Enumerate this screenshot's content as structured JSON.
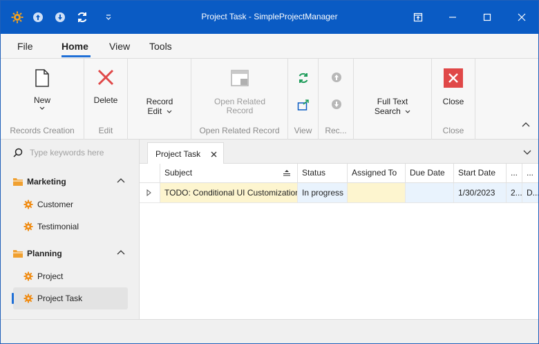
{
  "window": {
    "title": "Project Task - SimpleProjectManager"
  },
  "menu": {
    "tabs": [
      {
        "label": "File"
      },
      {
        "label": "Home"
      },
      {
        "label": "View"
      },
      {
        "label": "Tools"
      }
    ],
    "active_tab": "Home"
  },
  "ribbon": {
    "groups": {
      "records_creation": {
        "label": "Records Creation",
        "new_label": "New"
      },
      "edit": {
        "label": "Edit",
        "delete_label": "Delete"
      },
      "record_edit": {
        "label_line1": "Record",
        "label_line2": "Edit"
      },
      "open_related": {
        "label": "Open Related Record",
        "btn_line1": "Open Related",
        "btn_line2": "Record"
      },
      "view": {
        "label": "View"
      },
      "rec": {
        "label": "Rec..."
      },
      "search": {
        "line1": "Full Text",
        "line2": "Search"
      },
      "close": {
        "label": "Close",
        "close_label": "Close"
      }
    }
  },
  "sidebar": {
    "search_placeholder": "Type keywords here",
    "groups": [
      {
        "name": "Marketing",
        "items": [
          "Customer",
          "Testimonial"
        ]
      },
      {
        "name": "Planning",
        "items": [
          "Project",
          "Project Task"
        ]
      }
    ],
    "selected_item": "Project Task"
  },
  "document": {
    "tab_label": "Project Task"
  },
  "grid": {
    "columns": [
      "Subject",
      "Status",
      "Assigned To",
      "Due Date",
      "Start Date",
      "...",
      "..."
    ],
    "rows": [
      {
        "subject": "TODO: Conditional UI Customization",
        "status": "In progress",
        "assigned_to": "",
        "due_date": "",
        "start_date": "1/30/2023",
        "c6": "2...",
        "c7": "D..."
      }
    ]
  },
  "colors": {
    "titlebar": "#0a5bc4",
    "accent": "#1f6fd6",
    "folder": "#f0a030",
    "gear": "#f08c14",
    "delete_red": "#e04848",
    "refresh_green": "#1e9c5a"
  }
}
